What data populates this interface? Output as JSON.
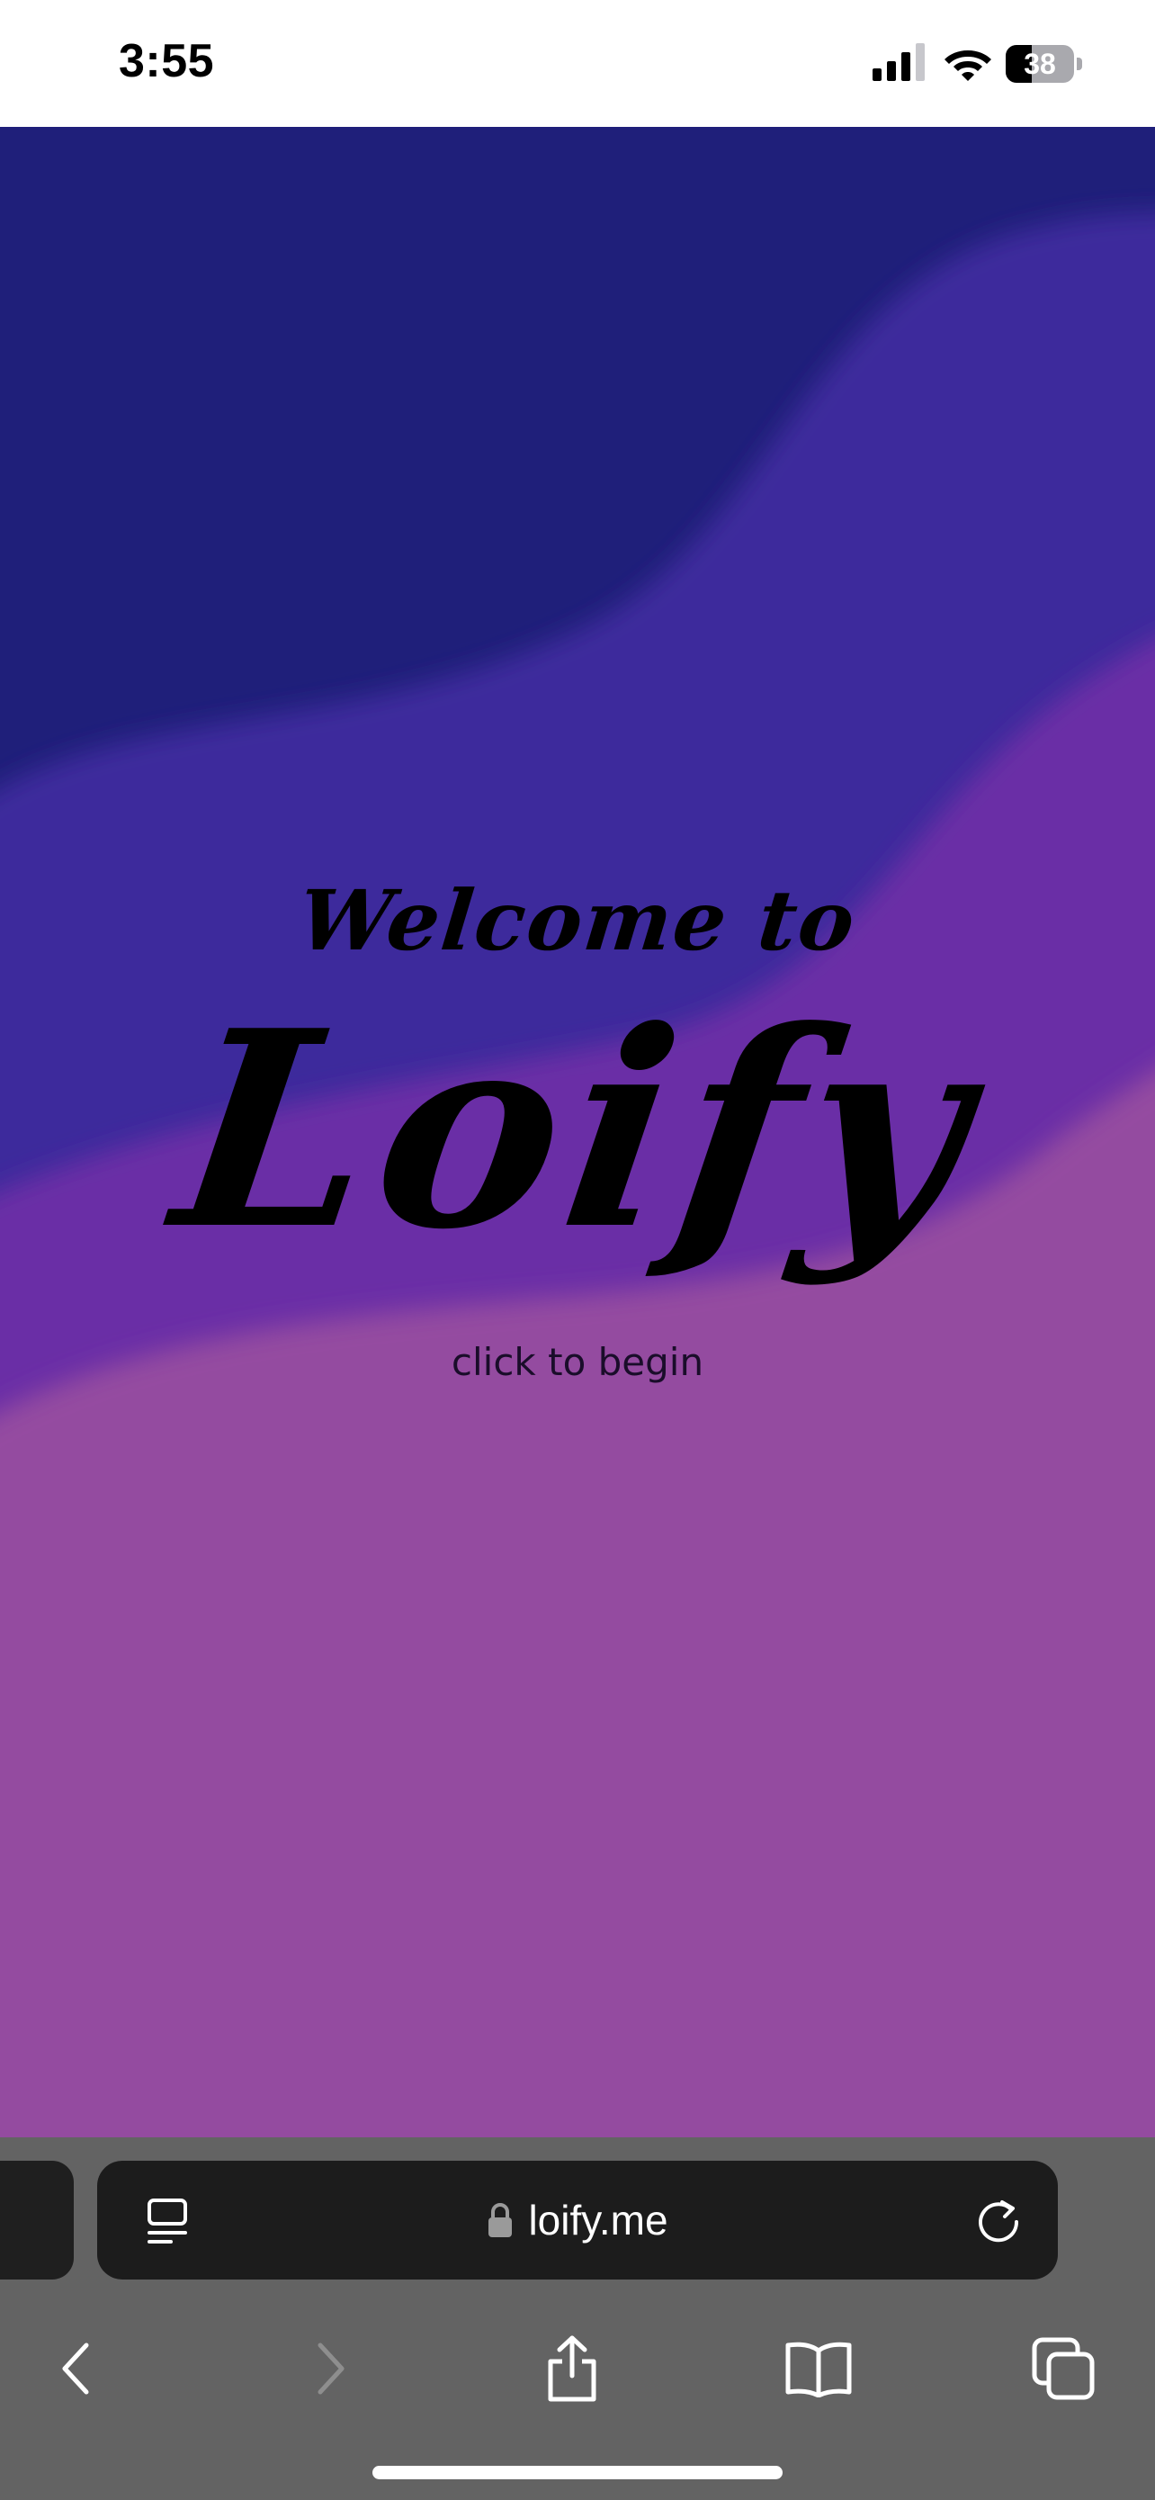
{
  "status_bar": {
    "time": "3:55",
    "battery_level": "38",
    "battery_fraction": 0.38,
    "icons": [
      "cellular-signal-icon",
      "wifi-icon",
      "battery-icon"
    ]
  },
  "page": {
    "subtitle": "Welcome to",
    "title": "Loify",
    "cta": "click to begin",
    "colors": {
      "band_top": "#1f1f7a",
      "band_indigo": "#3e2a9c",
      "band_violet": "#6b2ea6",
      "band_orchid": "#944ba0",
      "text": "#000000"
    }
  },
  "browser": {
    "url": "loify.me",
    "icons": {
      "reader": "reader-view-icon",
      "lock": "lock-icon",
      "reload": "reload-icon"
    },
    "toolbar": [
      {
        "name": "back-button",
        "icon": "chevron-left-icon",
        "enabled": true
      },
      {
        "name": "forward-button",
        "icon": "chevron-right-icon",
        "enabled": false
      },
      {
        "name": "share-button",
        "icon": "share-icon",
        "enabled": true
      },
      {
        "name": "bookmarks-button",
        "icon": "book-icon",
        "enabled": true
      },
      {
        "name": "tabs-button",
        "icon": "tabs-icon",
        "enabled": true
      }
    ],
    "colors": {
      "chrome": "#636363",
      "address_bar": "#1c1c1c",
      "icon": "#ffffff",
      "icon_disabled": "#8e8e8e"
    }
  }
}
